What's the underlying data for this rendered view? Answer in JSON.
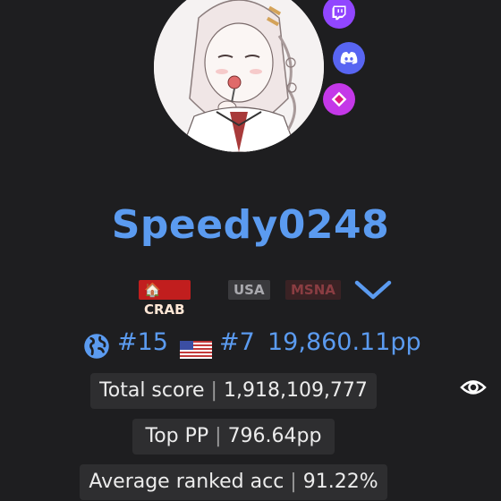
{
  "profile": {
    "username": "Speedy0248",
    "avatar_alt": "",
    "socials": [
      {
        "name": "twitch",
        "color": "#9146ff"
      },
      {
        "name": "discord",
        "color": "#5865f2"
      },
      {
        "name": "beatleader",
        "color": "#c438e8"
      }
    ]
  },
  "clans": [
    {
      "tag": "CRAB",
      "prefix": "🏠",
      "color": "#c11e1e"
    },
    {
      "tag": "USA",
      "color": "#3a3a3d"
    },
    {
      "tag": "MSNA",
      "color": "#3a2224"
    }
  ],
  "ranks": {
    "global_rank": "#15",
    "country_rank": "#7",
    "pp": "19,860.11pp",
    "country_flag": "us-flag-icon"
  },
  "stats": {
    "total_score_label": "Total score",
    "total_score_value": "1,918,109,777",
    "top_pp_label": "Top PP",
    "top_pp_value": "796.64pp",
    "avg_acc_label": "Average ranked acc",
    "avg_acc_value": "91.22%"
  },
  "colors": {
    "accent": "#5b9bf0",
    "background": "#1e1e20",
    "pill": "#2e2e30"
  }
}
